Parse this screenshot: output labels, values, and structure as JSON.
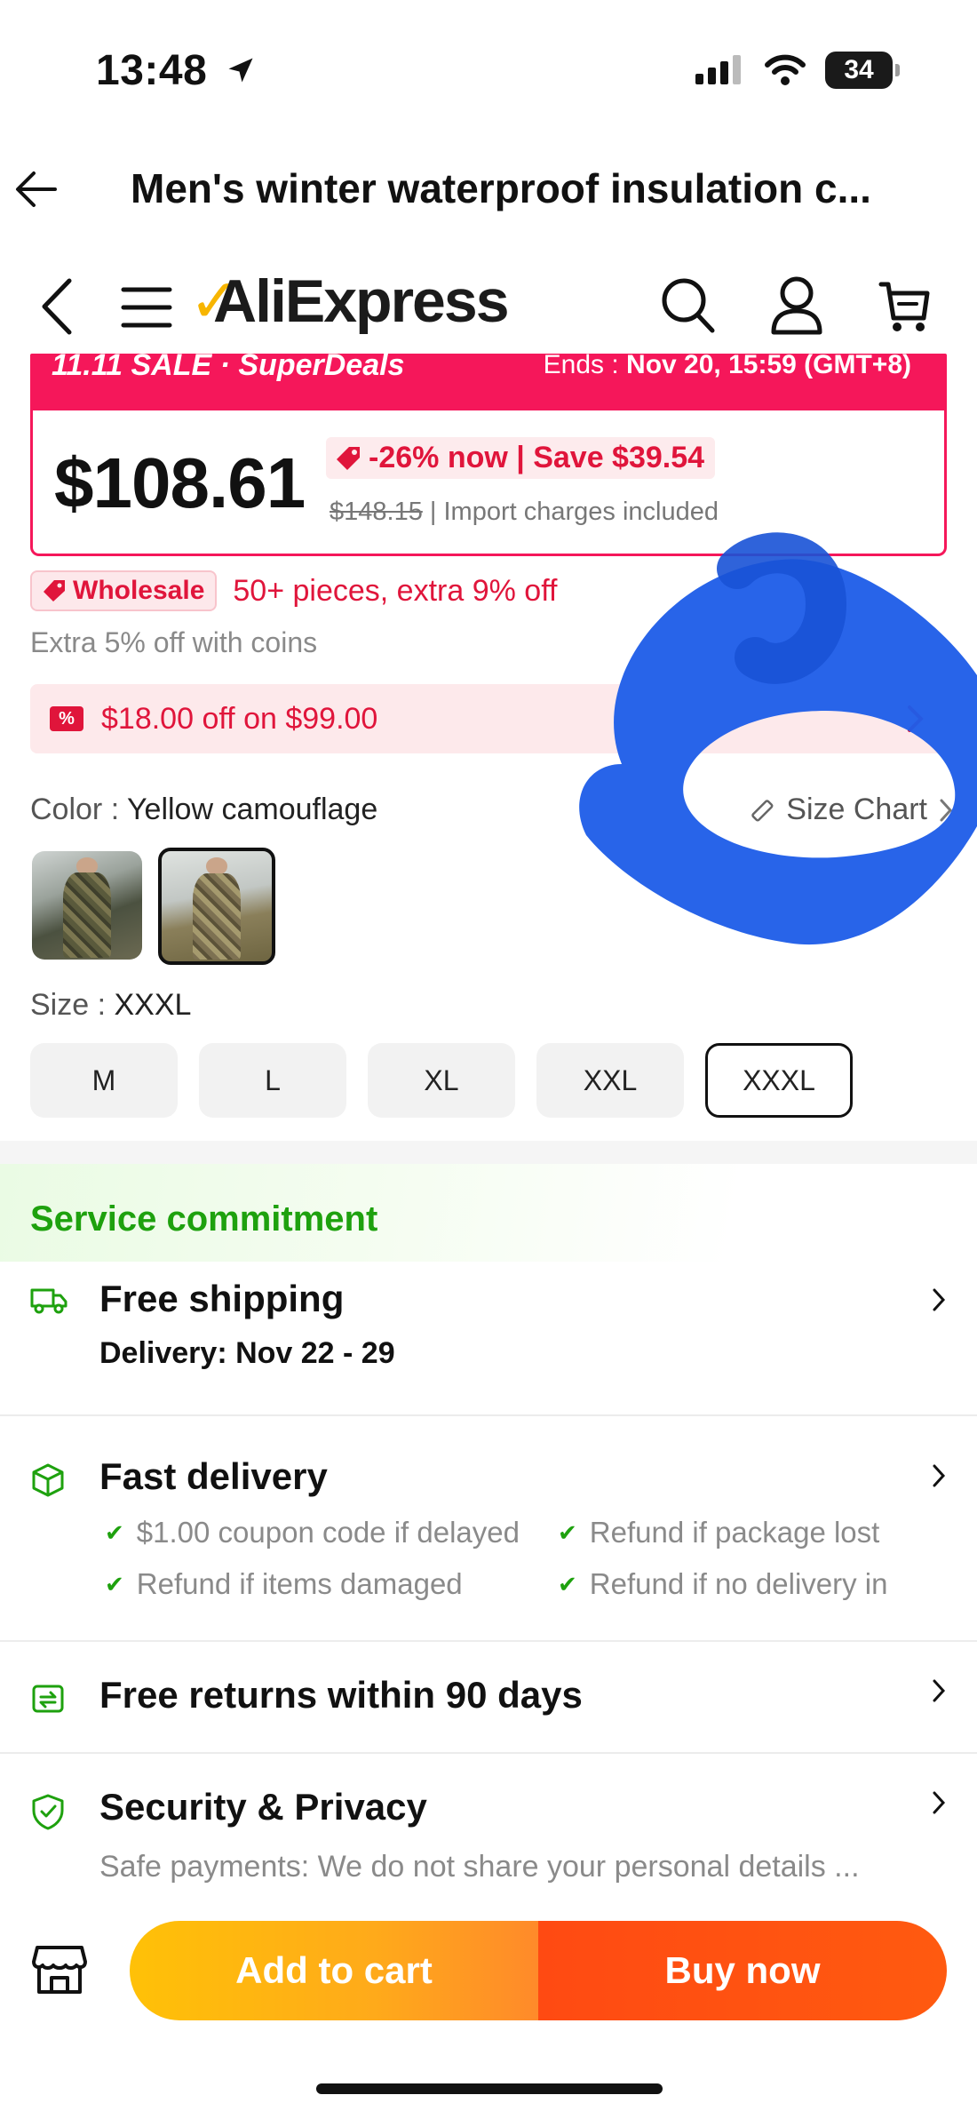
{
  "status": {
    "time": "13:48",
    "battery": "34"
  },
  "title_bar": {
    "title": "Men's winter waterproof insulation c..."
  },
  "app_bar": {
    "logo": "AliExpress"
  },
  "sale": {
    "label": "11.11 SALE · SuperDeals",
    "ends_label": "Ends :",
    "ends_value": "Nov 20, 15:59 (GMT+8)"
  },
  "price": {
    "current": "$108.61",
    "discount": "-26% now | Save $39.54",
    "original": "$148.15",
    "note": "| Import charges included"
  },
  "wholesale": {
    "badge": "Wholesale",
    "text": "50+ pieces, extra 9% off"
  },
  "coins": {
    "text": "Extra 5% off with coins"
  },
  "coupon": {
    "icon": "%",
    "text": "$18.00 off on $99.00"
  },
  "color": {
    "label": "Color :",
    "value": "Yellow camouflage",
    "size_chart": "Size Chart"
  },
  "size": {
    "label": "Size :",
    "value": "XXXL",
    "options": [
      "M",
      "L",
      "XL",
      "XXL",
      "XXXL"
    ],
    "selected": "XXXL"
  },
  "service": {
    "title": "Service commitment",
    "shipping": {
      "title": "Free shipping",
      "delivery_label": "Delivery:",
      "delivery_value": "Nov 22 - 29"
    },
    "fast": {
      "title": "Fast delivery",
      "checks": [
        "$1.00 coupon code if delayed",
        "Refund if package lost",
        "Refund if items damaged",
        "Refund if no delivery in"
      ]
    },
    "returns": {
      "title": "Free returns within 90 days"
    },
    "security": {
      "title": "Security & Privacy",
      "desc": "Safe payments: We do not share your personal details ..."
    }
  },
  "actions": {
    "add_to_cart": "Add to cart",
    "buy_now": "Buy now"
  },
  "colors": {
    "accent_red": "#f5175a",
    "green": "#1ea10e",
    "cta_yellow": "#ffc107",
    "cta_orange": "#ff4a12",
    "scribble_blue": "#1f5ee8"
  }
}
